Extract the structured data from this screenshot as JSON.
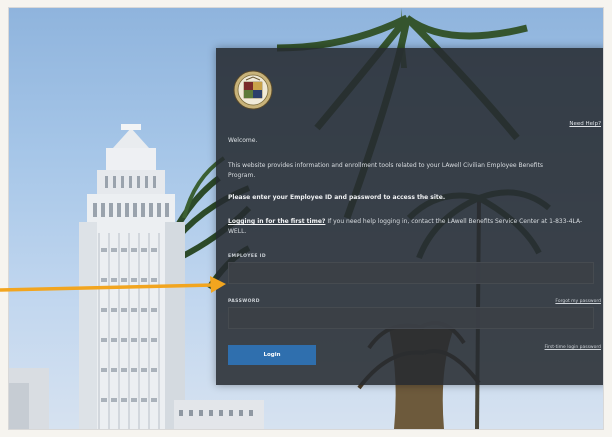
{
  "seal": {
    "icon": "city-seal-icon"
  },
  "login": {
    "need_help": "Need Help?",
    "welcome": "Welcome.",
    "intro": "This website provides information and enrollment tools related to your LAwell Civilian Employee Benefits Program.",
    "instruction": "Please enter your Employee ID and password to access the site.",
    "first_time_link": "Logging in for the first time?",
    "first_time_text": " If you need help logging in, contact the LAwell Benefits Service Center at 1-833-4LA-WELL.",
    "employee_id_label": "EMPLOYEE ID",
    "employee_id_value": "",
    "password_label": "PASSWORD",
    "password_value": "",
    "forgot_password": "Forgot my password",
    "login_button": "Login",
    "first_time_login": "First-time login password"
  },
  "colors": {
    "panel": "#262a30",
    "button": "#2f6fae",
    "arrow": "#f2a51f"
  }
}
